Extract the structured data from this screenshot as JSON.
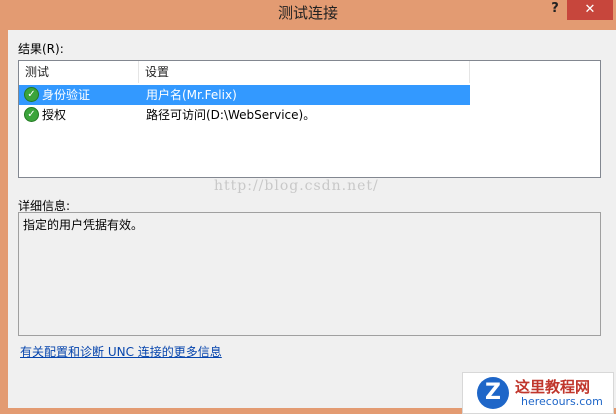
{
  "window": {
    "title": "测试连接",
    "help_label": "?",
    "close_label": "✕"
  },
  "results": {
    "label": "结果(R):",
    "columns": [
      "测试",
      "设置"
    ],
    "rows": [
      {
        "test": "身份验证",
        "setting": "用户名(Mr.Felix)",
        "status": "check-icon",
        "selected": true
      },
      {
        "test": "授权",
        "setting": "路径可访问(D:\\WebService)。",
        "status": "check-icon",
        "selected": false
      }
    ]
  },
  "details": {
    "label": "详细信息:",
    "text": "指定的用户凭据有效。"
  },
  "link": {
    "text": "有关配置和诊断 UNC 连接的更多信息"
  },
  "watermark": "http://blog.csdn.net/",
  "logo": {
    "letter": "Z",
    "title": "这里教程网",
    "url": "herecours.com"
  },
  "colors": {
    "titlebar": "#e39b72",
    "selection": "#3399ff",
    "close": "#c7463c",
    "link": "#0645ad"
  }
}
